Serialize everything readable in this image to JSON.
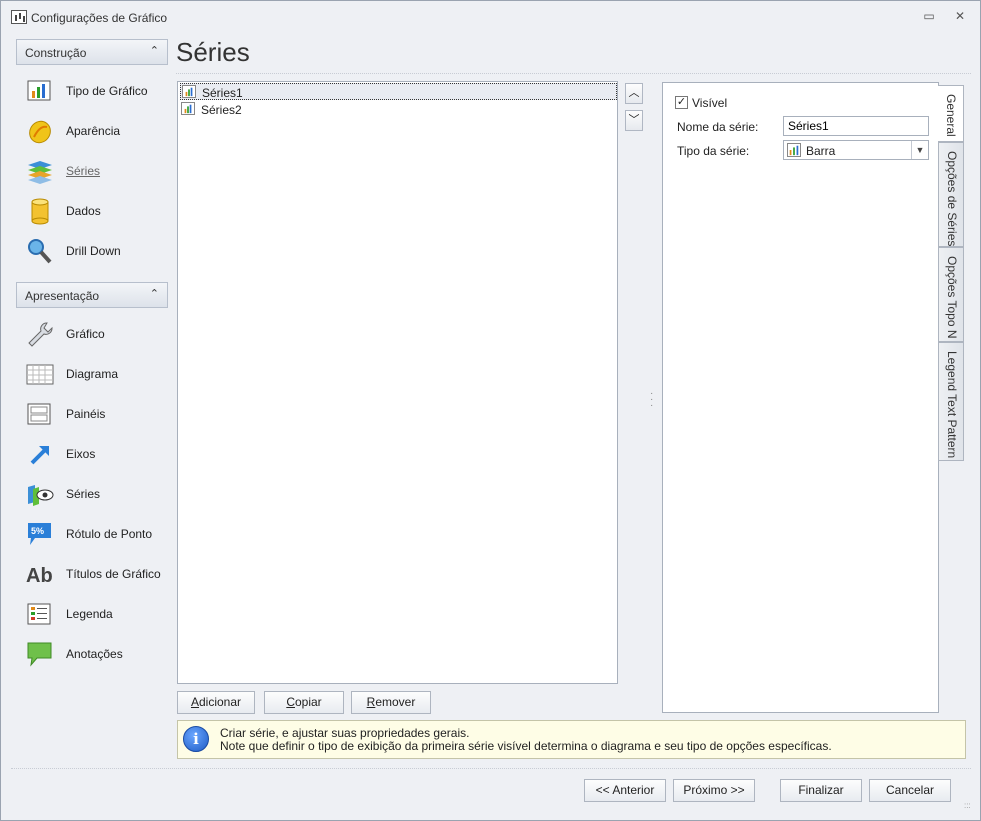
{
  "window": {
    "title": "Configurações de Gráfico",
    "restore_icon": "▭",
    "close_icon": "✕"
  },
  "page_title": "Séries",
  "nav": {
    "construcao": {
      "header": "Construção",
      "items": [
        {
          "label": "Tipo de Gráfico",
          "icon": "chart-type-icon"
        },
        {
          "label": "Aparência",
          "icon": "appearance-icon"
        },
        {
          "label": "Séries",
          "icon": "series-icon",
          "active": true
        },
        {
          "label": "Dados",
          "icon": "data-icon"
        },
        {
          "label": "Drill Down",
          "icon": "drill-down-icon"
        }
      ]
    },
    "apresentacao": {
      "header": "Apresentação",
      "items": [
        {
          "label": "Gráfico",
          "icon": "wrench-icon"
        },
        {
          "label": "Diagrama",
          "icon": "diagram-icon"
        },
        {
          "label": "Painéis",
          "icon": "panes-icon"
        },
        {
          "label": "Eixos",
          "icon": "axes-icon"
        },
        {
          "label": "Séries",
          "icon": "series-view-icon"
        },
        {
          "label": "Rótulo de Ponto",
          "icon": "point-label-icon"
        },
        {
          "label": "Títulos de Gráfico",
          "icon": "chart-titles-icon"
        },
        {
          "label": "Legenda",
          "icon": "legend-icon"
        },
        {
          "label": "Anotações",
          "icon": "annotations-icon"
        }
      ]
    }
  },
  "series_list": [
    {
      "label": "Séries1",
      "selected": true
    },
    {
      "label": "Séries2",
      "selected": false
    }
  ],
  "list_buttons": {
    "add": {
      "accel": "A",
      "rest": "dicionar"
    },
    "copy": {
      "accel": "C",
      "rest": "opiar"
    },
    "remove": {
      "accel": "R",
      "rest": "emover"
    }
  },
  "props": {
    "visible_label": "Visível",
    "visible_checked": true,
    "name_label": "Nome da série:",
    "name_value": "Séries1",
    "type_label": "Tipo da série:",
    "type_value": "Barra"
  },
  "tabs": [
    "General",
    "Opções de Séries",
    "Opções Topo N",
    "Legend Text Pattern"
  ],
  "info": {
    "line1": "Criar série, e ajustar suas propriedades gerais.",
    "line2": "Note que definir o tipo de exibição da primeira série visível determina o diagrama e seu tipo de opções específicas."
  },
  "footer": {
    "previous": "<< Anterior",
    "next": "Próximo >>",
    "finish": "Finalizar",
    "cancel": "Cancelar"
  }
}
